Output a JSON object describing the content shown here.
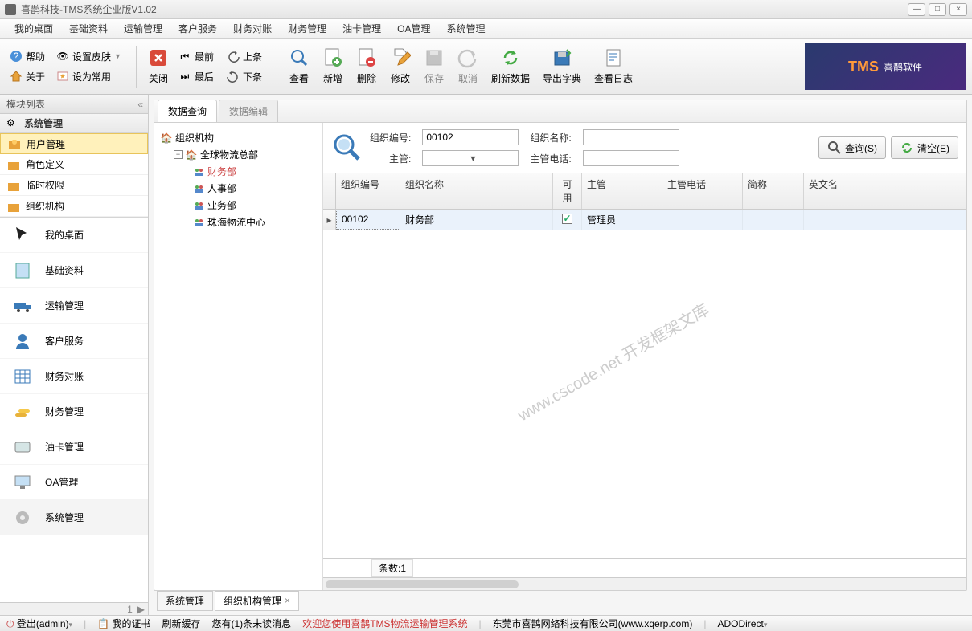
{
  "title": "喜鹊科技-TMS系统企业版V1.02",
  "menu": [
    "我的桌面",
    "基础资料",
    "运输管理",
    "客户服务",
    "财务对账",
    "财务管理",
    "油卡管理",
    "OA管理",
    "系统管理"
  ],
  "toolbar": {
    "help": "帮助",
    "skin": "设置皮肤",
    "about": "关于",
    "fav": "设为常用",
    "close": "关闭",
    "first": "最前",
    "last": "最后",
    "prev": "上条",
    "next": "下条",
    "view": "查看",
    "add": "新增",
    "del": "删除",
    "edit": "修改",
    "save": "保存",
    "cancel": "取消",
    "refresh": "刷新数据",
    "export": "导出字典",
    "log": "查看日志"
  },
  "brand": {
    "prefix": "TMS",
    "name": "喜鹊软件"
  },
  "sidebar": {
    "header": "模块列表",
    "accordion": "系统管理",
    "items": [
      "用户管理",
      "角色定义",
      "临时权限",
      "组织机构"
    ],
    "nav": [
      "我的桌面",
      "基础资料",
      "运输管理",
      "客户服务",
      "财务对账",
      "财务管理",
      "油卡管理",
      "OA管理",
      "系统管理"
    ]
  },
  "innerTabs": {
    "active": "数据查询",
    "inactive": "数据编辑"
  },
  "tree": {
    "root": "组织机构",
    "node": "全球物流总部",
    "leaves": [
      "财务部",
      "人事部",
      "业务部",
      "珠海物流中心"
    ]
  },
  "filter": {
    "orgCodeLabel": "组织编号:",
    "orgCode": "00102",
    "orgNameLabel": "组织名称:",
    "orgName": "",
    "supLabel": "主管:",
    "sup": "",
    "supTelLabel": "主管电话:",
    "supTel": "",
    "searchBtn": "查询(S)",
    "clearBtn": "清空(E)"
  },
  "grid": {
    "headers": [
      "组织编号",
      "组织名称",
      "可用",
      "主管",
      "主管电话",
      "简称",
      "英文名"
    ],
    "row": {
      "code": "00102",
      "name": "财务部",
      "enabled": true,
      "sup": "管理员",
      "tel": "",
      "short": "",
      "en": ""
    },
    "count": "条数:1"
  },
  "watermark": "www.cscode.net\n开发框架文库",
  "bottomTabs": [
    "系统管理",
    "组织机构管理"
  ],
  "status": {
    "logout": "登出(admin)",
    "cert": "我的证书",
    "refresh": "刷新缓存",
    "msg": "您有(1)条未读消息",
    "welcome": "欢迎您使用喜鹊TMS物流运输管理系统",
    "company": "东莞市喜鹊网络科技有限公司(www.xqerp.com)",
    "db": "ADODirect"
  }
}
